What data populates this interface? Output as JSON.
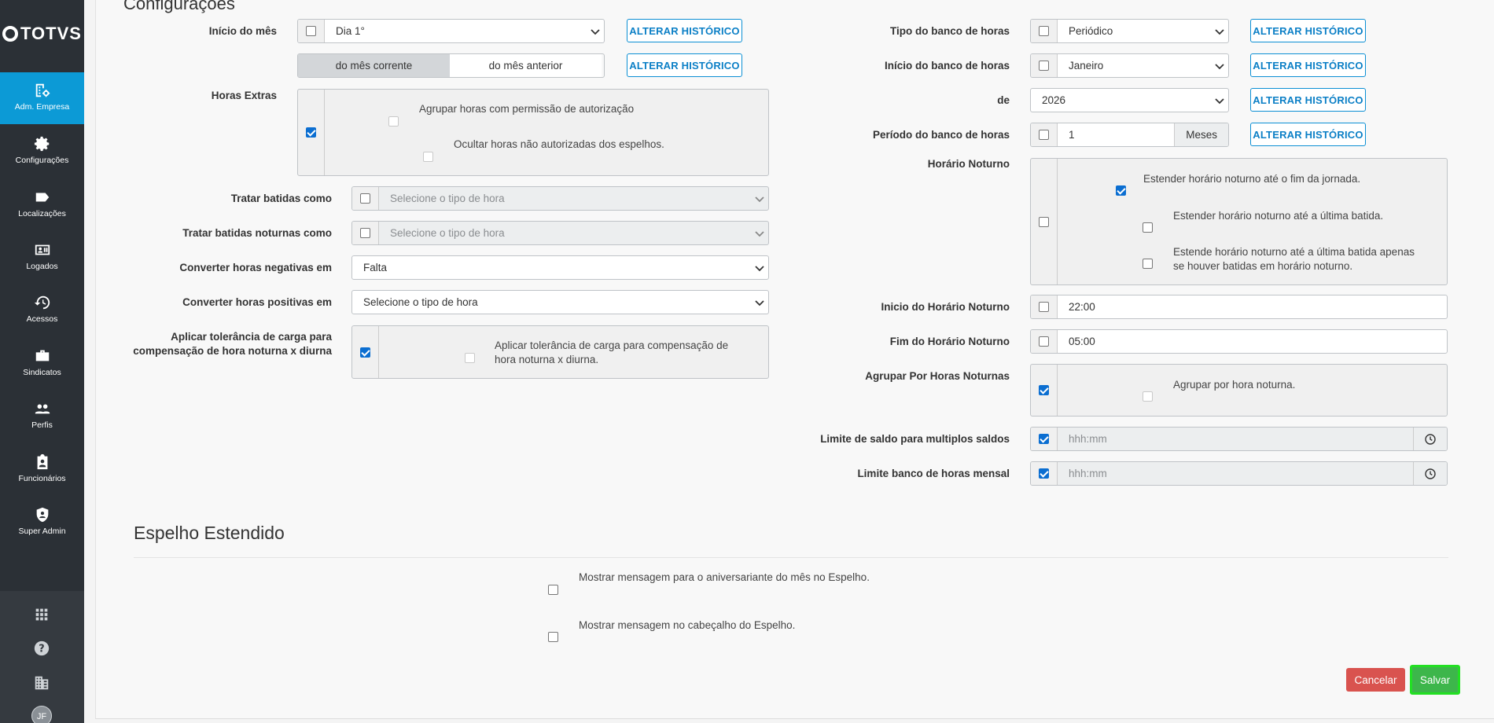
{
  "brand": "TOTVS",
  "sidebar": {
    "items": [
      {
        "label": "Adm. Empresa",
        "icon": "building-cog-icon",
        "active": true
      },
      {
        "label": "Configurações",
        "icon": "gear-icon"
      },
      {
        "label": "Localizações",
        "icon": "tag-icon"
      },
      {
        "label": "Logados",
        "icon": "id-card-icon"
      },
      {
        "label": "Acessos",
        "icon": "history-icon"
      },
      {
        "label": "Sindicatos",
        "icon": "briefcase-icon"
      },
      {
        "label": "Perfis",
        "icon": "people-icon"
      },
      {
        "label": "Funcionários",
        "icon": "clipboard-user-icon"
      },
      {
        "label": "Super Admin",
        "icon": "shield-user-icon"
      }
    ],
    "bottom_icons": [
      "apps-grid-icon",
      "help-icon",
      "company-icon"
    ],
    "avatar_initials": "JF"
  },
  "page_title": "Configurações",
  "left": {
    "inicio_mes": {
      "label": "Início do mês",
      "value": "Dia 1°",
      "btn": "ALTERAR HISTÓRICO"
    },
    "mes_toggle": {
      "options": [
        "do mês corrente",
        "do mês anterior"
      ],
      "selected": 0,
      "btn": "ALTERAR HISTÓRICO"
    },
    "horas_extras": {
      "label": "Horas Extras",
      "options": [
        "Agrupar horas com permissão de autorização",
        "Ocultar horas não autorizadas dos espelhos."
      ]
    },
    "tratar_batidas": {
      "label": "Tratar batidas como",
      "placeholder": "Selecione o tipo de hora"
    },
    "tratar_noturnas": {
      "label": "Tratar batidas noturnas como",
      "placeholder": "Selecione o tipo de hora"
    },
    "converter_negativas": {
      "label": "Converter horas negativas em",
      "value": "Falta"
    },
    "converter_positivas": {
      "label": "Converter horas positivas em",
      "value": "Selecione o tipo de hora"
    },
    "tolerancia": {
      "label_line1": "Aplicar tolerância de carga para",
      "label_line2": "compensação de hora noturna x diurna",
      "text_line1": "Aplicar tolerância de carga para compensação de",
      "text_line2": "hora noturna x diurna."
    }
  },
  "right": {
    "tipo_banco": {
      "label": "Tipo do banco de horas",
      "value": "Periódico",
      "btn": "ALTERAR HISTÓRICO"
    },
    "inicio_banco": {
      "label": "Início do banco de horas",
      "value": "Janeiro",
      "btn": "ALTERAR HISTÓRICO"
    },
    "ano": {
      "label": "de",
      "value": "2026",
      "btn": "ALTERAR HISTÓRICO"
    },
    "periodo": {
      "label": "Período do banco de horas",
      "value": "1",
      "addon": "Meses",
      "btn": "ALTERAR HISTÓRICO"
    },
    "horario_noturno": {
      "label": "Horário Noturno",
      "opt1": "Estender horário noturno até o fim da jornada.",
      "opt2": "Estender horário noturno até a última batida.",
      "opt3_line1": "Estende horário noturno até a última batida apenas",
      "opt3_line2": "se houver batidas em horário noturno."
    },
    "inicio_noturno": {
      "label": "Inicio do Horário Noturno",
      "value": "22:00"
    },
    "fim_noturno": {
      "label": "Fim do Horário Noturno",
      "value": "05:00"
    },
    "agrupar_noturnas": {
      "label": "Agrupar Por Horas Noturnas",
      "text": "Agrupar por hora noturna."
    },
    "limite_saldo": {
      "label": "Limite de saldo para multiplos saldos",
      "placeholder": "hhh:mm"
    },
    "limite_mensal": {
      "label": "Limite banco de horas mensal",
      "placeholder": "hhh:mm"
    }
  },
  "espelho": {
    "title": "Espelho Estendido",
    "opt1": "Mostrar mensagem para o aniversariante do mês no Espelho.",
    "opt2": "Mostrar mensagem no cabeçalho do Espelho."
  },
  "actions": {
    "cancel": "Cancelar",
    "save": "Salvar"
  },
  "colors": {
    "sidebar": "#2b3036",
    "active": "#0c9ad6",
    "link": "#0b7fc6",
    "cancel": "#d9534f",
    "save": "#3db64b"
  }
}
